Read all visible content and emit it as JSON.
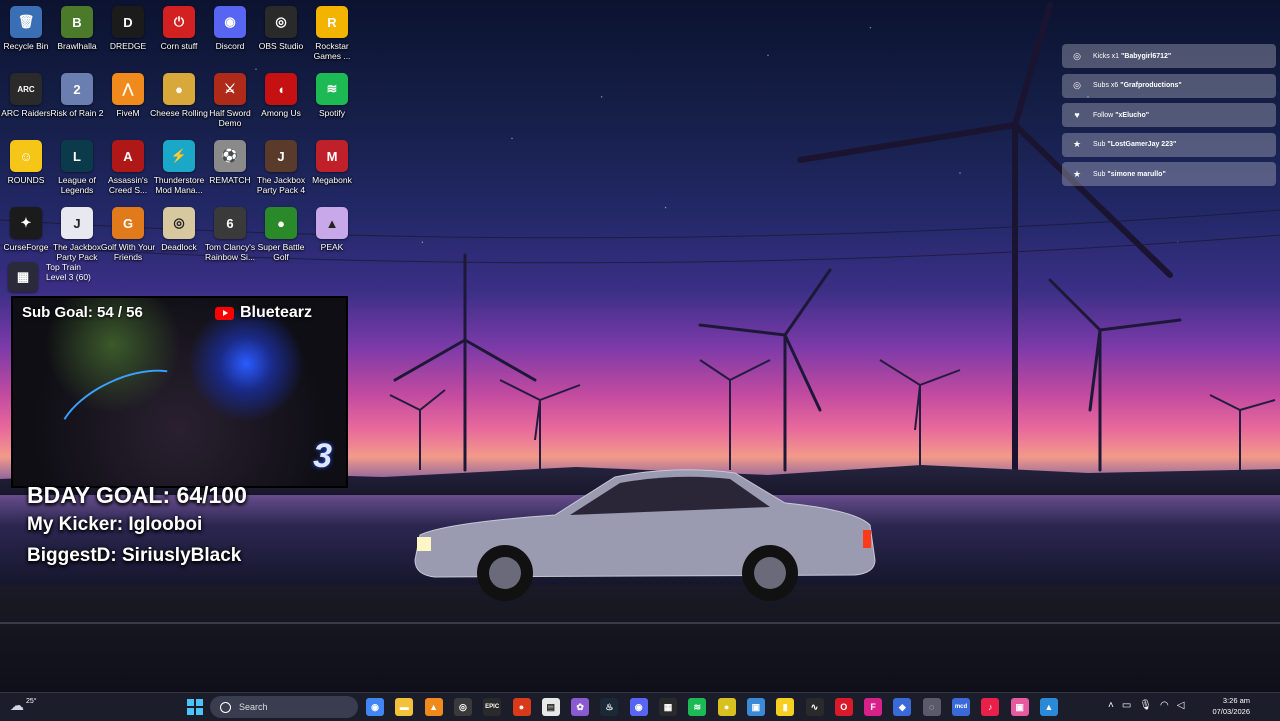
{
  "desktop_icons": [
    {
      "label": "Recycle Bin",
      "icon": "recycle-bin-icon",
      "color": "#3b6fb5",
      "glyph": "🗑"
    },
    {
      "label": "Brawlhalla",
      "icon": "brawlhalla-icon",
      "color": "#4a7a2a",
      "glyph": "B"
    },
    {
      "label": "DREDGE",
      "icon": "dredge-icon",
      "color": "#1b1b1b",
      "glyph": "D"
    },
    {
      "label": "Corn stuff",
      "icon": "corn-stuff-icon",
      "color": "#d32020",
      "glyph": "⏻"
    },
    {
      "label": "Discord",
      "icon": "discord-icon",
      "color": "#5865f2",
      "glyph": "◉"
    },
    {
      "label": "OBS Studio",
      "icon": "obs-studio-icon",
      "color": "#2a2a2a",
      "glyph": "◎"
    },
    {
      "label": "Rockstar Games ...",
      "icon": "rockstar-games-icon",
      "color": "#f2b400",
      "glyph": "R"
    },
    {
      "label": "ARC Raiders",
      "icon": "arc-raiders-icon",
      "color": "#2a2a2a",
      "glyph": "ARC"
    },
    {
      "label": "Risk of Rain 2",
      "icon": "risk-of-rain-2-icon",
      "color": "#6a7fb0",
      "glyph": "2"
    },
    {
      "label": "FiveM",
      "icon": "fivem-icon",
      "color": "#f08a1c",
      "glyph": "⋀"
    },
    {
      "label": "Cheese Rolling",
      "icon": "cheese-rolling-icon",
      "color": "#d8a83a",
      "glyph": "●"
    },
    {
      "label": "Half Sword Demo",
      "icon": "half-sword-icon",
      "color": "#b02a1a",
      "glyph": "⚔"
    },
    {
      "label": "Among Us",
      "icon": "among-us-icon",
      "color": "#c51111",
      "glyph": "◖"
    },
    {
      "label": "Spotify",
      "icon": "spotify-icon",
      "color": "#1db954",
      "glyph": "≋"
    },
    {
      "label": "ROUNDS",
      "icon": "rounds-icon",
      "color": "#f5c518",
      "glyph": "☺"
    },
    {
      "label": "League of Legends",
      "icon": "league-of-legends-icon",
      "color": "#0b3a4a",
      "glyph": "L"
    },
    {
      "label": "Assassin's Creed S...",
      "icon": "assassins-creed-icon",
      "color": "#b01818",
      "glyph": "A"
    },
    {
      "label": "Thunderstore Mod Mana...",
      "icon": "thunderstore-icon",
      "color": "#1aa7c8",
      "glyph": "⚡"
    },
    {
      "label": "REMATCH",
      "icon": "rematch-icon",
      "color": "#8a8a8a",
      "glyph": "⚽"
    },
    {
      "label": "The Jackbox Party Pack 4",
      "icon": "jackbox-4-icon",
      "color": "#5a3a2a",
      "glyph": "J"
    },
    {
      "label": "Megabonk",
      "icon": "megabonk-icon",
      "color": "#c0202a",
      "glyph": "M"
    },
    {
      "label": "CurseForge",
      "icon": "curseforge-icon",
      "color": "#1b1b1b",
      "glyph": "✦"
    },
    {
      "label": "The Jackbox Party Pack",
      "icon": "jackbox-icon",
      "color": "#e8e8f0",
      "glyph": "J"
    },
    {
      "label": "Golf With Your Friends",
      "icon": "golf-with-friends-icon",
      "color": "#e07a1a",
      "glyph": "G"
    },
    {
      "label": "Deadlock",
      "icon": "deadlock-icon",
      "color": "#d8c8a0",
      "glyph": "◎"
    },
    {
      "label": "Tom Clancy's Rainbow Si...",
      "icon": "rainbow-six-icon",
      "color": "#3a3a3a",
      "glyph": "6"
    },
    {
      "label": "Super Battle Golf",
      "icon": "super-battle-golf-icon",
      "color": "#2a8a2a",
      "glyph": "●"
    },
    {
      "label": "PEAK",
      "icon": "peak-icon",
      "color": "#c8a8e8",
      "glyph": "▲"
    }
  ],
  "top_train": {
    "title": "Top Train",
    "level": "Level 3  (60)"
  },
  "notifications": [
    {
      "icon": "kick-icon",
      "glyph": "◎",
      "prefix": "Kicks x1 ",
      "name": "\"Babygirl6712\""
    },
    {
      "icon": "sub-icon",
      "glyph": "◎",
      "prefix": "Subs x6 ",
      "name": "\"Grafproductions\""
    },
    {
      "icon": "heart-icon",
      "glyph": "♥",
      "prefix": "Follow ",
      "name": "\"xElucho\""
    },
    {
      "icon": "star-icon",
      "glyph": "★",
      "prefix": "Sub ",
      "name": "\"LostGamerJay 223\""
    },
    {
      "icon": "star-icon",
      "glyph": "★",
      "prefix": "Sub ",
      "name": "\"simone marullo\""
    }
  ],
  "webcam": {
    "sub_goal": "Sub Goal:  54 / 56",
    "channel": "Bluetearz",
    "logo": "3"
  },
  "overlay": {
    "bday_goal": "BDAY GOAL: 64/100",
    "kicker": "My Kicker: Iglooboi",
    "biggest": "BiggestD: SiriuslyBlack"
  },
  "taskbar": {
    "weather": "25°",
    "search_placeholder": "Search",
    "apps": [
      {
        "name": "chrome-icon",
        "color": "#4285f4",
        "glyph": "◉"
      },
      {
        "name": "file-explorer-icon",
        "color": "#f3c13a",
        "glyph": "▬"
      },
      {
        "name": "vlc-icon",
        "color": "#f08a1c",
        "glyph": "▲"
      },
      {
        "name": "obs-icon",
        "color": "#3a3a3a",
        "glyph": "◎"
      },
      {
        "name": "epic-games-icon",
        "color": "#2a2a2a",
        "glyph": "EPIC"
      },
      {
        "name": "app-red-icon",
        "color": "#d83a1a",
        "glyph": "●"
      },
      {
        "name": "app-notes-icon",
        "color": "#e8e8e8",
        "glyph": "▤"
      },
      {
        "name": "app-purple-icon",
        "color": "#8a5ad0",
        "glyph": "✿"
      },
      {
        "name": "steam-icon",
        "color": "#1b2838",
        "glyph": "♨"
      },
      {
        "name": "discord-taskbar-icon",
        "color": "#5865f2",
        "glyph": "◉"
      },
      {
        "name": "app-dark-icon",
        "color": "#2a2a2a",
        "glyph": "▦"
      },
      {
        "name": "spotify-taskbar-icon",
        "color": "#1db954",
        "glyph": "≋"
      },
      {
        "name": "app-yellow-icon",
        "color": "#d8c020",
        "glyph": "●"
      },
      {
        "name": "app-photo-icon",
        "color": "#3a8ad8",
        "glyph": "▣"
      },
      {
        "name": "sticky-notes-icon",
        "color": "#f5d020",
        "glyph": "▮"
      },
      {
        "name": "app-wave-icon",
        "color": "#2a2a2a",
        "glyph": "∿"
      },
      {
        "name": "opera-icon",
        "color": "#d81a2a",
        "glyph": "O"
      },
      {
        "name": "app-f-icon",
        "color": "#d8208a",
        "glyph": "F"
      },
      {
        "name": "app-diamond-icon",
        "color": "#3a6ad8",
        "glyph": "◆"
      },
      {
        "name": "app-circle-icon",
        "color": "#5a5a6a",
        "glyph": "◌"
      },
      {
        "name": "app-mcd-icon",
        "color": "#3a6ad8",
        "glyph": "mcd"
      },
      {
        "name": "tiktok-icon",
        "color": "#e8204a",
        "glyph": "♪"
      },
      {
        "name": "app-pink-icon",
        "color": "#e85aa0",
        "glyph": "▣"
      },
      {
        "name": "app-blue-icon",
        "color": "#2a8ad8",
        "glyph": "▲"
      }
    ],
    "time": "3:26 am",
    "date": "07/03/2026"
  }
}
